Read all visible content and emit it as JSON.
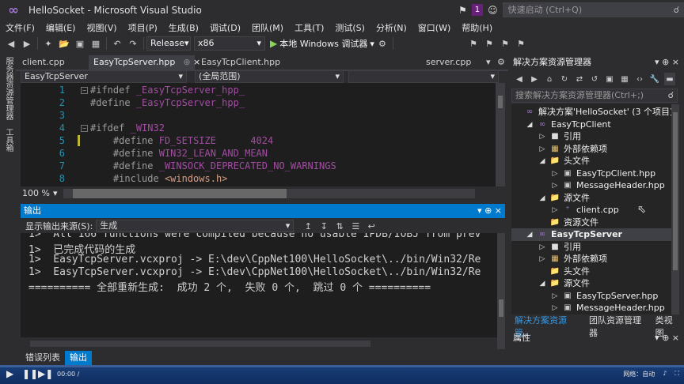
{
  "window": {
    "title": "HelloSocket - Microsoft Visual Studio",
    "notification_count": "1",
    "quick_launch_placeholder": "快速启动 (Ctrl+Q)"
  },
  "menu": [
    "文件(F)",
    "编辑(E)",
    "视图(V)",
    "项目(P)",
    "生成(B)",
    "调试(D)",
    "团队(M)",
    "工具(T)",
    "测试(S)",
    "分析(N)",
    "窗口(W)",
    "帮助(H)"
  ],
  "toolbar": {
    "configuration": "Release",
    "platform": "x86",
    "run_label": "本地 Windows 调试器"
  },
  "left_strip": [
    "服务器资源管理器",
    "工具箱"
  ],
  "doc_tabs": [
    "client.cpp",
    "EasyTcpServer.hpp",
    "EasyTcpClient.hpp",
    "server.cpp"
  ],
  "navbar": {
    "scope": "EasyTcpServer",
    "member": "(全局范围)"
  },
  "editor": {
    "lines": [
      {
        "num": "1",
        "kw": "#ifndef",
        "rest": "_EasyTcpServer_hpp_",
        "rest_class": "mac",
        "indent": ""
      },
      {
        "num": "2",
        "kw": "#define",
        "rest": "_EasyTcpServer_hpp_",
        "rest_class": "mac",
        "indent": ""
      },
      {
        "num": "3",
        "kw": "",
        "rest": "",
        "rest_class": "",
        "indent": ""
      },
      {
        "num": "4",
        "kw": "#ifdef",
        "rest": "_WIN32",
        "rest_class": "mac",
        "indent": ""
      },
      {
        "num": "5",
        "kw": "#define",
        "rest": "FD_SETSIZE      4024",
        "rest_class": "mac",
        "indent": "    "
      },
      {
        "num": "6",
        "kw": "#define",
        "rest": "WIN32_LEAN_AND_MEAN",
        "rest_class": "mac",
        "indent": "    "
      },
      {
        "num": "7",
        "kw": "#define",
        "rest": "_WINSOCK_DEPRECATED_NO_WARNINGS",
        "rest_class": "mac",
        "indent": "    "
      },
      {
        "num": "8",
        "kw": "#include",
        "rest": "<windows.h>",
        "rest_class": "hdr",
        "indent": "    "
      }
    ],
    "zoom": "100 %"
  },
  "output": {
    "title": "输出",
    "source_label": "显示输出来源(S):",
    "source_value": "生成",
    "lines": [
      "1>  All 166 functions were compiled because no usable IPDB/IOBJ from prev",
      "1>  已完成代码的生成",
      "1>  EasyTcpServer.vcxproj -> E:\\dev\\CppNet100\\HelloSocket\\../bin/Win32/Re",
      "1>  EasyTcpServer.vcxproj -> E:\\dev\\CppNet100\\HelloSocket\\../bin/Win32/Re",
      "========== 全部重新生成:  成功 2 个,  失败 0 个,  跳过 0 个 =========="
    ]
  },
  "bottom_tabs": [
    "错误列表",
    "输出"
  ],
  "solution_explorer": {
    "title": "解决方案资源管理器",
    "search_placeholder": "搜索解决方案资源管理器(Ctrl+;)",
    "tree": [
      {
        "label": "解决方案'HelloSocket' (3 个项目)",
        "level": 0,
        "icon": "sol",
        "twisty": "",
        "bold": false
      },
      {
        "label": "EasyTcpClient",
        "level": 1,
        "icon": "proj",
        "twisty": "open",
        "bold": false
      },
      {
        "label": "引用",
        "level": 2,
        "icon": "ref",
        "twisty": "closed",
        "bold": false
      },
      {
        "label": "外部依赖项",
        "level": 2,
        "icon": "ext",
        "twisty": "closed",
        "bold": false
      },
      {
        "label": "头文件",
        "level": 2,
        "icon": "folder",
        "twisty": "open",
        "bold": false
      },
      {
        "label": "EasyTcpClient.hpp",
        "level": 3,
        "icon": "h",
        "twisty": "closed",
        "bold": false
      },
      {
        "label": "MessageHeader.hpp",
        "level": 3,
        "icon": "h",
        "twisty": "closed",
        "bold": false
      },
      {
        "label": "源文件",
        "level": 2,
        "icon": "folder",
        "twisty": "open",
        "bold": false
      },
      {
        "label": "client.cpp",
        "level": 3,
        "icon": "cpp",
        "twisty": "closed",
        "bold": false
      },
      {
        "label": "资源文件",
        "level": 2,
        "icon": "folder",
        "twisty": "",
        "bold": false
      },
      {
        "label": "EasyTcpServer",
        "level": 1,
        "icon": "proj",
        "twisty": "open",
        "bold": true
      },
      {
        "label": "引用",
        "level": 2,
        "icon": "ref",
        "twisty": "closed",
        "bold": false
      },
      {
        "label": "外部依赖项",
        "level": 2,
        "icon": "ext",
        "twisty": "closed",
        "bold": false
      },
      {
        "label": "头文件",
        "level": 2,
        "icon": "folder",
        "twisty": "",
        "bold": false
      },
      {
        "label": "源文件",
        "level": 2,
        "icon": "folder",
        "twisty": "open",
        "bold": false
      },
      {
        "label": "EasyTcpServer.hpp",
        "level": 3,
        "icon": "h",
        "twisty": "closed",
        "bold": false
      },
      {
        "label": "MessageHeader.hpp",
        "level": 3,
        "icon": "h",
        "twisty": "closed",
        "bold": false
      }
    ],
    "bottom_tabs": [
      "解决方案资源管...",
      "团队资源管理器",
      "类视图"
    ]
  },
  "properties": {
    "title": "属性"
  },
  "player": {
    "time": "00:00 /",
    "right_label": "网络：自动"
  },
  "colors": {
    "accent": "#007acc",
    "background": "#2d2d30",
    "editor_bg": "#1e1e1e",
    "macro": "#a34ca3",
    "line_number": "#2b91af"
  }
}
